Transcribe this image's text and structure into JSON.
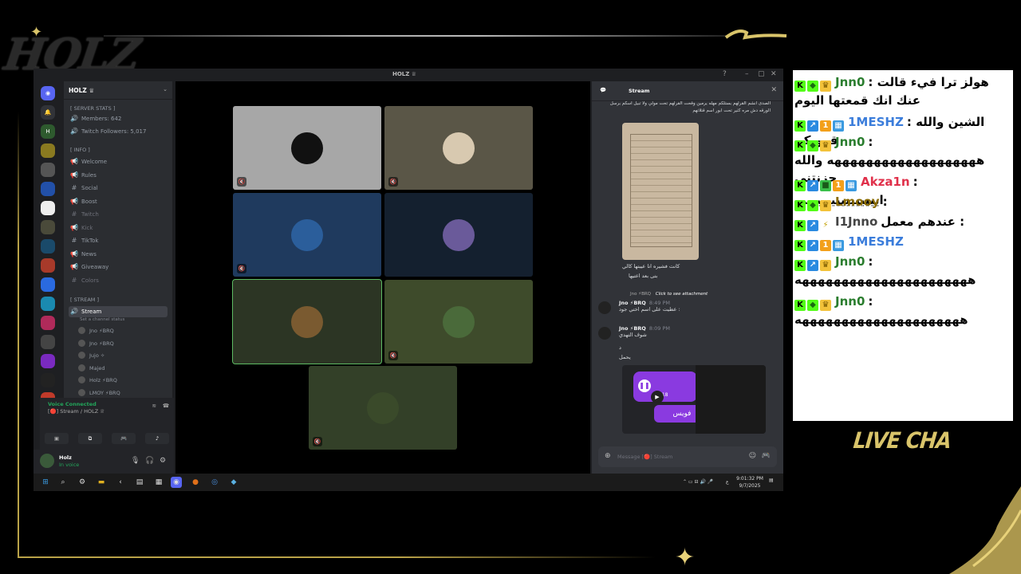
{
  "overlay": {
    "logo": "HOLZ",
    "live_chat_title": "LIVE CHA"
  },
  "discord": {
    "window_title": "HOLZ ♕",
    "server": {
      "name": "HOLZ ♕",
      "categories": {
        "stats": "[ SERVER STATS ]",
        "info": "[ INFO ]",
        "stream": "[ STREAM ]"
      },
      "stats": [
        {
          "label": "Members: 642"
        },
        {
          "label": "Twitch Followers: 5,017"
        }
      ],
      "info_channels": [
        {
          "icon": "📢",
          "name": "Welcome",
          "dim": false
        },
        {
          "icon": "📢",
          "name": "Rules",
          "dim": false
        },
        {
          "icon": "#",
          "name": "Social",
          "dim": false
        },
        {
          "icon": "📢",
          "name": "Boost",
          "dim": false
        },
        {
          "icon": "#",
          "name": "Twitch",
          "dim": true
        },
        {
          "icon": "📢",
          "name": "Kick",
          "dim": true
        },
        {
          "icon": "#",
          "name": "TikTok",
          "dim": false
        },
        {
          "icon": "📢",
          "name": "News",
          "dim": false
        },
        {
          "icon": "📢",
          "name": "Giveaway",
          "dim": false
        },
        {
          "icon": "#",
          "name": "Colors",
          "dim": true
        }
      ],
      "voice_channel": {
        "name": "Stream",
        "status": "Set a channel status",
        "users": [
          "Jno ⚡BRQ",
          "Jno ⚡BRQ",
          "Jujo ✧",
          "Majed",
          "Holz ⚡BRQ",
          "LMOY ⚡BRQ"
        ]
      }
    },
    "voice_panel": {
      "status": "Voice Connected",
      "channel": "[🔴] Stream / HOLZ ♕"
    },
    "user_panel": {
      "name": "Holz",
      "status": "In voice"
    },
    "chat": {
      "channel": "Stream",
      "top_text": "الصدى انشم القرلهم بستلكم مهله يرمين وقحت القرلهم تحت مولي ولا تبيل اسكم برسل الورقه دش مره كثير تحت ابور اسم قتلاتهم",
      "image_caption": "كانت فشيره انا عيبتها كالي",
      "image_caption2": "بتى بعد اعتيها",
      "reply_hint": "Click to see attachment",
      "reply_user": "Jno ⚡BRQ",
      "messages": [
        {
          "author": "Jno ⚡BRQ",
          "time": "8:49 PM",
          "text": "عطيت على اسم اختي جود :"
        },
        {
          "author": "Jno ⚡BRQ",
          "time": "8:09 PM",
          "text": "شوف التهدي"
        },
        {
          "author": "",
          "time": "",
          "text": "د"
        },
        {
          "author": "",
          "time": "",
          "text": "يحمل"
        }
      ],
      "voice_msg_time": "0:18",
      "voice_msg_label": "فويس",
      "input_placeholder": "Message [🔴] Stream"
    },
    "taskbar": {
      "time": "9:01:32 PM",
      "date": "9/7/2025",
      "lang": "ع"
    }
  },
  "live_chat": [
    {
      "badges": [
        "k",
        "diamond",
        "crown"
      ],
      "user": "Jnn0",
      "user_color": "#2a7d2e",
      "text": "هولز ترا فيء قالت : عنك انك قمعتها اليوم"
    },
    {
      "badges": [
        "k",
        "arrow",
        "one",
        "grid"
      ],
      "user": "1MESHZ",
      "user_color": "#3b7ddb",
      "text": "الشين والله : قرويكم"
    },
    {
      "badges": [
        "k",
        "diamond",
        "crown"
      ],
      "user": "Jnn0",
      "user_color": "#2a7d2e",
      "text": ": هههههههههههههههههههه والله حزنتني"
    },
    {
      "badges": [
        "k",
        "arrow",
        "cube",
        "one",
        "grid"
      ],
      "user": "Akza1n",
      "user_color": "#e0304a",
      "text": ": ايييييييييييييييي"
    },
    {
      "badges": [
        "k",
        "diamond",
        "crown"
      ],
      "user": "Lmooy",
      "user_color": "#8a6b00",
      "text": ":"
    },
    {
      "badges": [
        "k",
        "arrow",
        "bolt"
      ],
      "user": "I1Jnno",
      "user_color": "#444444",
      "text": "عندهم معمل :"
    },
    {
      "badges": [
        "k",
        "arrow",
        "one",
        "grid"
      ],
      "user": "1MESHZ",
      "user_color": "#3b7ddb",
      "text": ""
    },
    {
      "badges": [
        "k",
        "arrow",
        "crown"
      ],
      "user": "Jnn0",
      "user_color": "#2a7d2e",
      "text": ": ههههههههههههههههههههههه"
    },
    {
      "badges": [
        "k",
        "diamond",
        "crown"
      ],
      "user": "Jnn0",
      "user_color": "#2a7d2e",
      "text": ": هههههههههههههههههههههه"
    }
  ]
}
